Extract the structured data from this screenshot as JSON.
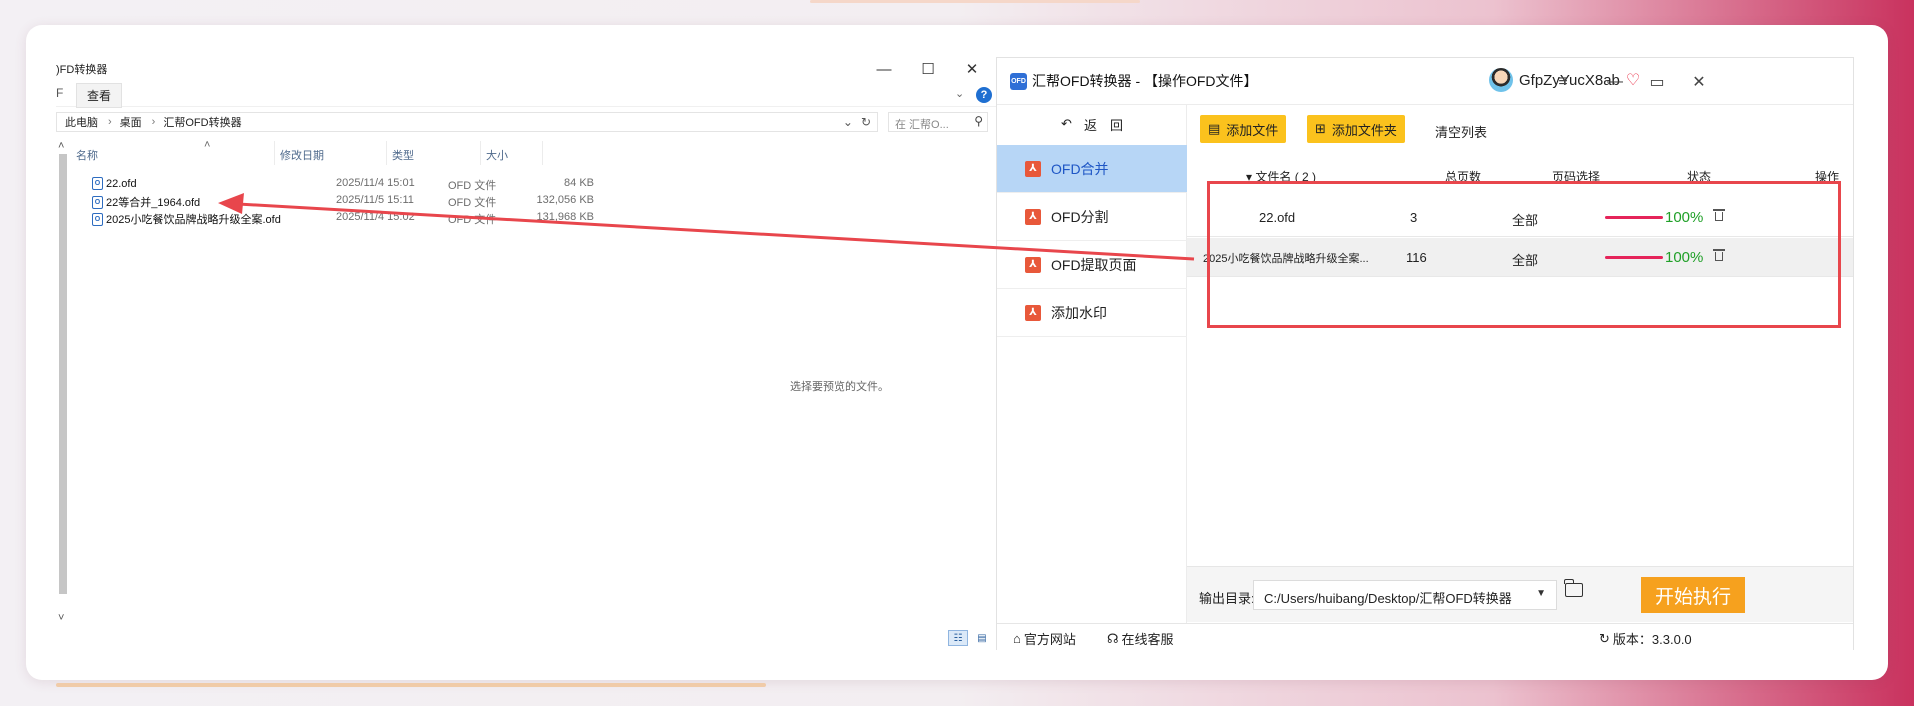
{
  "explorer": {
    "title": "OFD转换器",
    "title_visible": ")FD转换器",
    "ribbon": {
      "stub": "F",
      "view_tab": "查看"
    },
    "window_controls": [
      "—",
      "☐",
      "✕"
    ],
    "address": {
      "crumbs": [
        "此电脑",
        "桌面",
        "汇帮OFD转换器"
      ]
    },
    "search_placeholder": "在 汇帮O...",
    "columns": {
      "name": "名称",
      "date": "修改日期",
      "type": "类型",
      "size": "大小"
    },
    "files": [
      {
        "name": "22.ofd",
        "date": "2025/11/4 15:01",
        "type": "OFD 文件",
        "size": "84 KB"
      },
      {
        "name": "22等合并_1964.ofd",
        "date": "2025/11/5 15:11",
        "type": "OFD 文件",
        "size": "132,056 KB"
      },
      {
        "name": "2025小吃餐饮品牌战略升级全案.ofd",
        "date": "2025/11/4 15:02",
        "type": "OFD 文件",
        "size": "131,968 KB"
      }
    ],
    "preview_text": "选择要预览的文件。"
  },
  "converter": {
    "logo_text": "OFD",
    "title": "汇帮OFD转换器 - 【操作OFD文件】",
    "username": "GfpZyYucX8ab",
    "back_label": "返　回",
    "sidebar": [
      {
        "label": "OFD合并",
        "active": true
      },
      {
        "label": "OFD分割",
        "active": false
      },
      {
        "label": "OFD提取页面",
        "active": false
      },
      {
        "label": "添加水印",
        "active": false
      }
    ],
    "toolbar": {
      "add_file": "添加文件",
      "add_folder": "添加文件夹",
      "clear_list": "清空列表"
    },
    "table": {
      "headers": {
        "filename": "▾ 文件名 ( 2 )",
        "pages": "总页数",
        "page_select": "页码选择",
        "status": "状态",
        "action": "操作"
      },
      "rows": [
        {
          "filename": "22.ofd",
          "pages": "3",
          "page_select": "全部",
          "progress": "100%"
        },
        {
          "filename": "2025小吃餐饮品牌战略升级全案...",
          "pages": "116",
          "page_select": "全部",
          "progress": "100%"
        }
      ]
    },
    "footer": {
      "output_label": "输出目录:",
      "output_path": "C:/Users/huibang/Desktop/汇帮OFD转换器",
      "start_button": "开始执行"
    },
    "status_bar": {
      "website": "官方网站",
      "support": "在线客服",
      "version": "版本：3.3.0.0"
    }
  },
  "colors": {
    "accent_yellow": "#fbc21d",
    "start_orange": "#f6a11e",
    "active_blue": "#b7d6f6",
    "highlight_red": "#e8464c",
    "success_green": "#20a028"
  }
}
